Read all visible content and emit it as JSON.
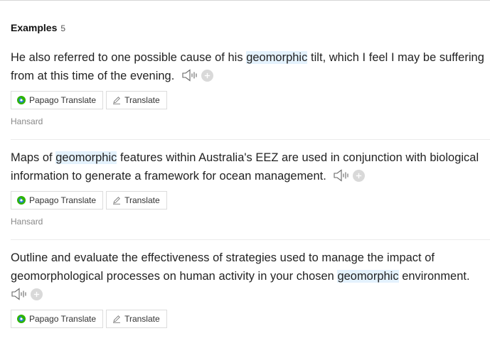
{
  "header": {
    "title": "Examples",
    "count": "5"
  },
  "examples": [
    {
      "before": "He also referred to one possible cause of his ",
      "highlight": "geomorphic",
      "after": " tilt, which I feel I may be suffering from at this time of the evening.",
      "papago_label": "Papago Translate",
      "translate_label": "Translate",
      "source": "Hansard"
    },
    {
      "before": "Maps of ",
      "highlight": "geomorphic",
      "after": " features within Australia's EEZ are used in conjunction with biological information to generate a framework for ocean management.",
      "papago_label": "Papago Translate",
      "translate_label": "Translate",
      "source": "Hansard"
    },
    {
      "before": "Outline and evaluate the effectiveness of strategies used to manage the impact of geomorphological processes on human activity in your chosen ",
      "highlight": "geomorphic",
      "after": " environment.",
      "papago_label": "Papago Translate",
      "translate_label": "Translate"
    }
  ],
  "colors": {
    "highlight": "#e4f2fd",
    "papago_green": "#2db400",
    "papago_blue": "#2a7fd9"
  },
  "icons": {
    "speaker": "speaker-icon",
    "add": "add-plus-icon",
    "papago": "papago-logo-icon",
    "pen": "pen-icon"
  }
}
